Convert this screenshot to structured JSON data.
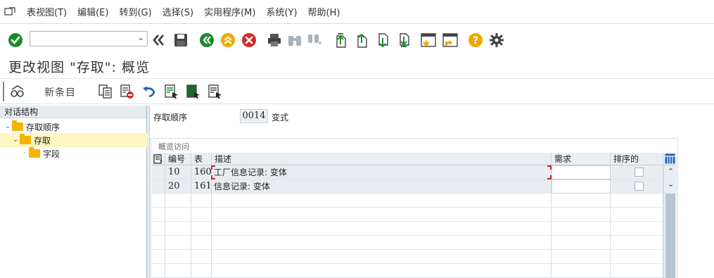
{
  "menubar": {
    "items": [
      "表视图(T)",
      "编辑(E)",
      "转到(G)",
      "选择(S)",
      "实用程序(M)",
      "系统(Y)",
      "帮助(H)"
    ]
  },
  "toolbar": {
    "icons": [
      "enter-icon",
      "back-icon",
      "save-icon",
      "back-green-icon",
      "exit-icon",
      "cancel-icon",
      "print-icon",
      "find-icon",
      "find-next-icon",
      "first-page-icon",
      "previous-page-icon",
      "next-page-icon",
      "last-page-icon",
      "create-session-icon",
      "shortcut-icon",
      "help-icon",
      "settings-icon"
    ],
    "colors": {
      "green": "#1b8a2b",
      "orange": "#f0a800",
      "red": "#d32b2b"
    }
  },
  "title": "更改视图 \"存取\": 概览",
  "apptoolbar": {
    "new_entries": "新条目"
  },
  "tree": {
    "header": "对话结构",
    "items": [
      {
        "label": "存取顺序",
        "expanded": true,
        "selected": false
      },
      {
        "label": "存取",
        "expanded": true,
        "selected": true
      },
      {
        "label": "字段",
        "expanded": false,
        "selected": false
      }
    ]
  },
  "main": {
    "access_seq_label": "存取顺序",
    "access_seq_value": "0014",
    "access_seq_suffix": "变式",
    "group_title": "概览访问",
    "table": {
      "columns": [
        "编号",
        "表",
        "描述",
        "需求",
        "排序的"
      ],
      "rows": [
        {
          "no": "10",
          "table": "160",
          "desc": "工厂信息记录: 变体",
          "req": "",
          "sorted": false
        },
        {
          "no": "20",
          "table": "161",
          "desc": "信息记录: 变体",
          "req": "",
          "sorted": false
        }
      ]
    }
  }
}
